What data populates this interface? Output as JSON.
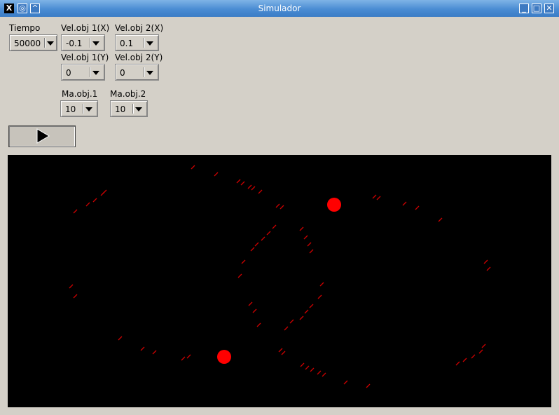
{
  "window": {
    "title": "Simulador",
    "icons": [
      "x-logo-icon",
      "pin-icon",
      "collapse-icon",
      "minimize-icon",
      "maximize-icon",
      "close-icon"
    ]
  },
  "controls": {
    "tiempo": {
      "label": "Tiempo",
      "value": "50000"
    },
    "vel1x": {
      "label": "Vel.obj 1(X)",
      "value": "-0.1"
    },
    "vel2x": {
      "label": "Vel.obj 2(X)",
      "value": "0.1"
    },
    "vel1y": {
      "label": "Vel.obj 1(Y)",
      "value": "0"
    },
    "vel2y": {
      "label": "Vel.obj 2(Y)",
      "value": "0"
    },
    "ma1": {
      "label": "Ma.obj.1",
      "value": "10"
    },
    "ma2": {
      "label": "Ma.obj.2",
      "value": "10"
    },
    "play_icon": "play-icon"
  },
  "colors": {
    "canvas_bg": "#000000",
    "object": "#ff0000",
    "titlebar": "#4a8cd3"
  }
}
